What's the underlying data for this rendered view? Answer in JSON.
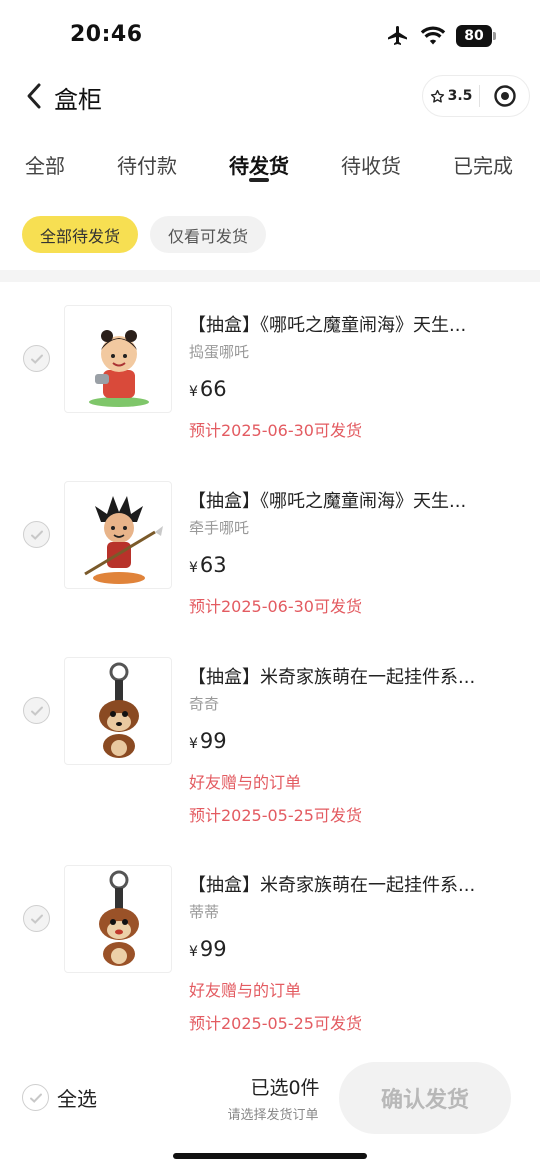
{
  "status_bar": {
    "time": "20:46",
    "battery": "80"
  },
  "header": {
    "title": "盒柜",
    "capsule_rating": "3.5"
  },
  "tabs": [
    {
      "label": "全部",
      "active": false
    },
    {
      "label": "待付款",
      "active": false
    },
    {
      "label": "待发货",
      "active": true
    },
    {
      "label": "待收货",
      "active": false
    },
    {
      "label": "已完成",
      "active": false
    }
  ],
  "filters": [
    {
      "label": "全部待发货",
      "active": true
    },
    {
      "label": "仅看可发货",
      "active": false
    }
  ],
  "orders": [
    {
      "title": "【抽盒】《哪吒之魔童闹海》天生...",
      "variant": "捣蛋哪吒",
      "currency": "¥",
      "price": "66",
      "gift_note": "",
      "ship_note": "预计2025-06-30可发货"
    },
    {
      "title": "【抽盒】《哪吒之魔童闹海》天生...",
      "variant": "牵手哪吒",
      "currency": "¥",
      "price": "63",
      "gift_note": "",
      "ship_note": "预计2025-06-30可发货"
    },
    {
      "title": "【抽盒】米奇家族萌在一起挂件系...",
      "variant": "奇奇",
      "currency": "¥",
      "price": "99",
      "gift_note": "好友赠与的订单",
      "ship_note": "预计2025-05-25可发货"
    },
    {
      "title": "【抽盒】米奇家族萌在一起挂件系...",
      "variant": "蒂蒂",
      "currency": "¥",
      "price": "99",
      "gift_note": "好友赠与的订单",
      "ship_note": "预计2025-05-25可发货"
    }
  ],
  "bottom_bar": {
    "select_all_label": "全选",
    "selected_count": "已选0件",
    "hint": "请选择发货订单",
    "confirm_label": "确认发货"
  },
  "colors": {
    "accent_yellow": "#f7df52",
    "warning_red": "#e35b61"
  }
}
